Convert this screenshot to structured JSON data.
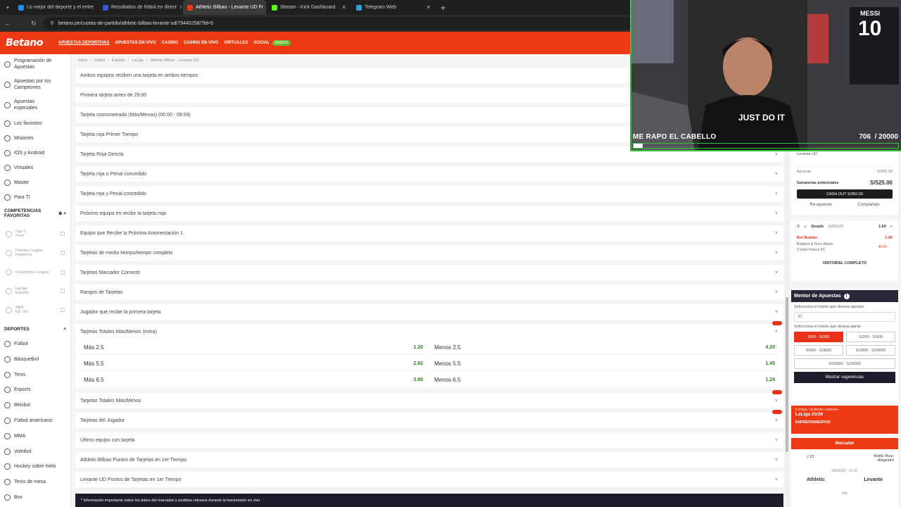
{
  "browser": {
    "tabs": [
      {
        "label": "Lo mejor del deporte y el entre",
        "color": "#1f8efa"
      },
      {
        "label": "Resultados de fútbol en direct",
        "color": "#3a58d6"
      },
      {
        "label": "Athletic Bilbao - Levante UD Fr",
        "color": "#ee3a14"
      },
      {
        "label": "Stream - Kick Dashboard",
        "color": "#53fc18"
      },
      {
        "label": "Telegram Web",
        "color": "#2aa3e0"
      }
    ],
    "url": "betano.pe/cuotas-de-partido/athletic-bilbao-levante-ud/79445258/?bt=5"
  },
  "brand": {
    "logo": "Betano",
    "color": "#ee3a14"
  },
  "nav": {
    "items": [
      "APUESTAS DEPORTIVAS",
      "APUESTAS EN VIVO",
      "CASINO",
      "CASINO EN VIVO",
      "VIRTUALES",
      "SOCIAL"
    ],
    "new_badge": "NUEVO"
  },
  "sidebar": {
    "items": [
      "Programación de Apuestas",
      "Apuestas por los Campeones",
      "Apuestas especiales",
      "Los favoritos",
      "Misiones",
      "IOS y Android",
      "Virtuales",
      "Master",
      "Para Ti"
    ],
    "comp_heading": "COMPETENCIAS FAVORITAS",
    "competitions": [
      {
        "name": "Liga 1",
        "sub": "Perú"
      },
      {
        "name": "Premier League",
        "sub": "Inglaterra"
      },
      {
        "name": "Champions League",
        "sub": ""
      },
      {
        "name": "LaLiga",
        "sub": "España"
      },
      {
        "name": "NBA",
        "sub": "EE. UU."
      }
    ],
    "sports_heading": "DEPORTES",
    "sports": [
      "Fútbol",
      "Básquetbol",
      "Tenis",
      "Esports",
      "Béisbol",
      "Fútbol americano",
      "MMA",
      "Voleibol",
      "Hockey sobre hielo",
      "Tenis de mesa",
      "Box"
    ]
  },
  "breadcrumb": [
    "Inicio",
    "Fútbol",
    "España",
    "LaLiga",
    "Athletic Bilbao - Levante UD"
  ],
  "markets_top": [
    "Ambos equipos reciben una tarjeta en ambos tiempos",
    "Primera tarjeta antes de 29:00",
    "Tarjeta cronometrada (Más/Menos) (00:00 - 09:59)",
    "Tarjeta roja Primer Tiempo",
    "Tarjeta Roja Directa",
    "Tarjeta roja o Penal concedido",
    "Tarjeta roja y Penal concedido",
    "Próximo equipo en recibir la tarjeta roja",
    "Equipo que Recibe la Próxima Amonestación 1",
    "Tarjetas de medio tiempo/tiempo completo",
    "Tarjetas Marcador Correcto",
    "Rangos de Tarjetas",
    "Jugador que recibe la primera tarjeta",
    "Tarjetas Totales Más/Menos (extra)"
  ],
  "odds": [
    {
      "over": "Más 2.5",
      "over_odd": "1.20",
      "under": "Menos 2.5",
      "under_odd": "4.20"
    },
    {
      "over": "Más 5.5",
      "over_odd": "2.62",
      "under": "Menos 5.5",
      "under_odd": "1.45"
    },
    {
      "over": "Más 6.5",
      "over_odd": "3.80",
      "under": "Menos 6.5",
      "under_odd": "1.24"
    }
  ],
  "markets_bottom": [
    "Tarjetas Totales Más/Menos",
    "Tarjetas del Jugador",
    "Último equipo con tarjeta",
    "Athletic Bilbao Puntos de Tarjetas en 1er Tiempo",
    "Levante UD Puntos de Tarjetas en 1er Tiempo"
  ],
  "footer_notice": "* Información importante sobre los datos del marcador y posibles retrasos durante la transmisión en vivo",
  "stream": {
    "caption": "ME RAPO EL CABELLO",
    "count": "706",
    "goal": "/ 20000",
    "shirt": "MESSI",
    "number": "10",
    "tshirt": "JUST DO IT"
  },
  "betslip": {
    "team": "Levante UD",
    "stake_label": "Apuesta",
    "stake": "S/350.00",
    "win_label": "Ganancias potenciales",
    "win": "S/525.00",
    "cashout": "CASH OUT  S/350.00",
    "rebet": "Re-apuesta",
    "share": "Compártelo",
    "simple_label": "Simple",
    "simple_amount": "S/250.00",
    "simple_odd": "1.60",
    "bb_label": "Bet Builder",
    "bb_odd": "1.60",
    "bb_match1": "Brighton & Hove Albion",
    "bb_match2": "Crystal Palace FC",
    "bb_stat": "45:00",
    "history": "HISTORIAL COMPLETO"
  },
  "mentor": {
    "title": "Mentor de Apuestas",
    "q1": "Selecciona el monto que deseas apostar",
    "amount": "30",
    "q2": "Selecciona el monto que deseas ganar",
    "options": [
      "S/60 - S/200",
      "S/200 - S/600",
      "S/600 - S/3000",
      "S/3000 - S/20000",
      "S/20000 - S/30000"
    ],
    "button": "Mostrar sugerencias"
  },
  "league": {
    "path": "FÚTBOL / EUROPA / ESPAÑA",
    "name": "LaLiga 25/26",
    "tab": "ENFRENTAMIENTOS"
  },
  "scoreboard": {
    "title": "Marcador",
    "ref": "Muñiz Ruiz, Alejandro",
    "date": "08/02/26 · 12:15",
    "home": "Athletic",
    "away": "Levante",
    "info": "Info",
    "round": "J 23"
  }
}
